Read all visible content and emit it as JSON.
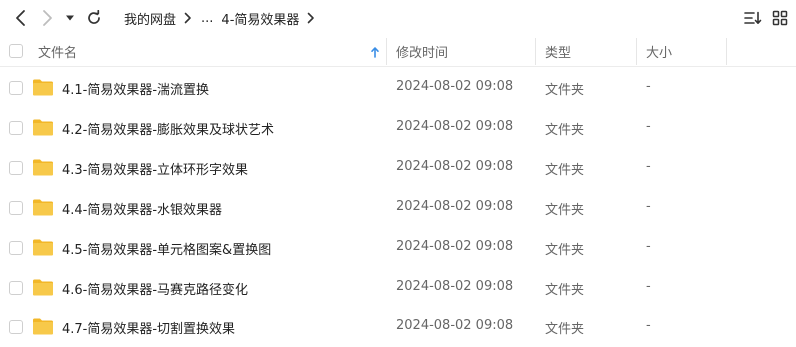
{
  "toolbar": {
    "back_icon": "chevron-left-icon",
    "forward_icon": "chevron-right-icon",
    "history_icon": "caret-down-icon",
    "refresh_icon": "refresh-icon",
    "breadcrumb": {
      "root": "我的网盘",
      "ellipsis": "...",
      "current": "4-简易效果器"
    },
    "sort_icon": "sort-list-icon",
    "view_icon": "grid-view-icon"
  },
  "table": {
    "columns": {
      "name": "文件名",
      "modified": "修改时间",
      "type": "类型",
      "size": "大小"
    },
    "sort_indicator_color": "#3a8ee6",
    "folder_color": "#f7c94a",
    "rows": [
      {
        "name": "4.1-简易效果器-湍流置换",
        "modified": "2024-08-02 09:08",
        "type": "文件夹",
        "size": "-"
      },
      {
        "name": "4.2-简易效果器-膨胀效果及球状艺术",
        "modified": "2024-08-02 09:08",
        "type": "文件夹",
        "size": "-"
      },
      {
        "name": "4.3-简易效果器-立体环形字效果",
        "modified": "2024-08-02 09:08",
        "type": "文件夹",
        "size": "-"
      },
      {
        "name": "4.4-简易效果器-水银效果器",
        "modified": "2024-08-02 09:08",
        "type": "文件夹",
        "size": "-"
      },
      {
        "name": "4.5-简易效果器-单元格图案&置换图",
        "modified": "2024-08-02 09:08",
        "type": "文件夹",
        "size": "-"
      },
      {
        "name": "4.6-简易效果器-马赛克路径变化",
        "modified": "2024-08-02 09:08",
        "type": "文件夹",
        "size": "-"
      },
      {
        "name": "4.7-简易效果器-切割置换效果",
        "modified": "2024-08-02 09:08",
        "type": "文件夹",
        "size": "-"
      }
    ]
  }
}
